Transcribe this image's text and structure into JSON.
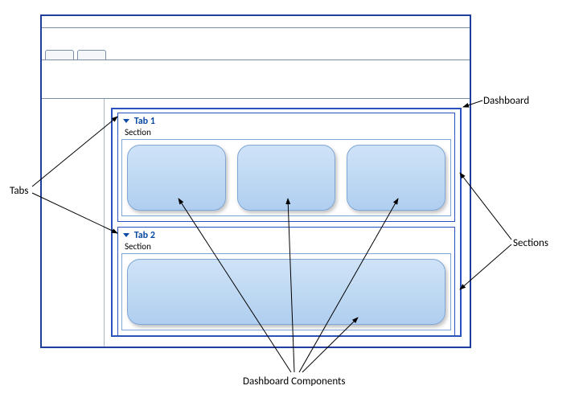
{
  "callouts": {
    "dashboard": "Dashboard",
    "tabs": "Tabs",
    "sections": "Sections",
    "components": "Dashboard Components"
  },
  "dashboard": {
    "tabs": [
      {
        "title": "Tab 1",
        "section_label": "Section",
        "components": [
          "",
          "",
          ""
        ]
      },
      {
        "title": "Tab 2",
        "section_label": "Section",
        "components": [
          ""
        ]
      }
    ]
  }
}
